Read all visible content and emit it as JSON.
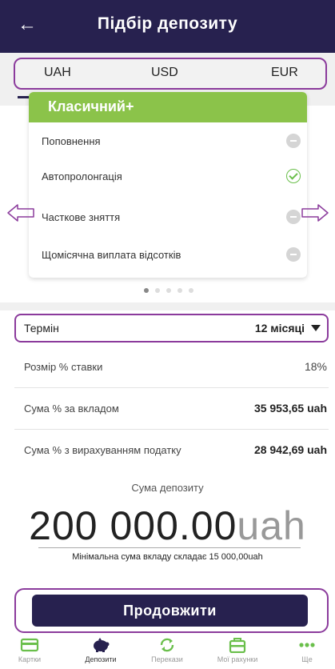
{
  "header": {
    "title": "Підбір депозиту",
    "back_icon": "arrow-left-icon"
  },
  "currency_tabs": [
    {
      "label": "UAH",
      "selected": true
    },
    {
      "label": "USD",
      "selected": false
    },
    {
      "label": "EUR",
      "selected": false
    }
  ],
  "deposit_card": {
    "title": "Класичний+",
    "features": [
      {
        "label": "Поповнення",
        "available": false
      },
      {
        "label": "Автопролонгація",
        "available": true
      },
      {
        "label": "Часткове зняття",
        "available": false
      },
      {
        "label": "Щомісячна виплата відсотків",
        "available": false
      }
    ]
  },
  "carousel": {
    "page_count": 5,
    "active_page": 1
  },
  "term": {
    "label": "Термін",
    "value": "12 місяці"
  },
  "details": [
    {
      "label": "Розмір % ставки",
      "value": "18%",
      "bold": false
    },
    {
      "label": "Сума % за вкладом",
      "value": "35 953,65 uah",
      "bold": true
    },
    {
      "label": "Сума % з вирахуванням податку",
      "value": "28 942,69 uah",
      "bold": true
    }
  ],
  "deposit": {
    "label": "Сума депозиту",
    "amount": "200 000.00",
    "unit": "uah",
    "min_note": "Мінімальна сума вкладу складає 15 000,00uah"
  },
  "continue_button": "Продовжити",
  "tabbar": [
    {
      "label": "Картки",
      "icon": "card-icon",
      "active": false
    },
    {
      "label": "Депозити",
      "icon": "piggy-bank-icon",
      "active": true
    },
    {
      "label": "Перекази",
      "icon": "transfer-icon",
      "active": false
    },
    {
      "label": "Мої рахунки",
      "icon": "wallet-icon",
      "active": false
    },
    {
      "label": "Ще",
      "icon": "more-icon",
      "active": false
    }
  ],
  "colors": {
    "header": "#27214f",
    "accent_green": "#8bc34a",
    "highlight": "#8b3b9c"
  }
}
